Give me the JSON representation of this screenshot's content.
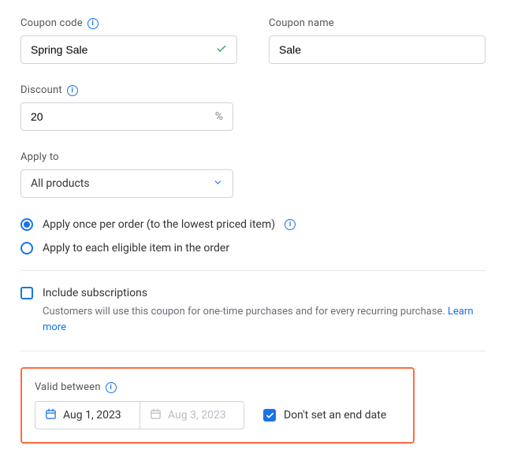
{
  "coupon_section": {
    "code_label": "Coupon code",
    "code_value": "Spring Sale",
    "name_label": "Coupon name",
    "name_value": "Sale"
  },
  "discount": {
    "label": "Discount",
    "value": "20",
    "suffix": "%"
  },
  "apply_to": {
    "label": "Apply to",
    "selected": "All products"
  },
  "apply_mode": {
    "once_label": "Apply once per order (to the lowest priced item)",
    "each_label": "Apply to each eligible item in the order"
  },
  "subscriptions": {
    "label": "Include subscriptions",
    "helper_prefix": "Customers will use this coupon for one-time purchases and for every recurring purchase. ",
    "learn_more": "Learn more"
  },
  "valid_between": {
    "label": "Valid between",
    "start": "Aug 1, 2023",
    "end_placeholder": "Aug 3, 2023",
    "no_end_label": "Don't set an end date"
  }
}
